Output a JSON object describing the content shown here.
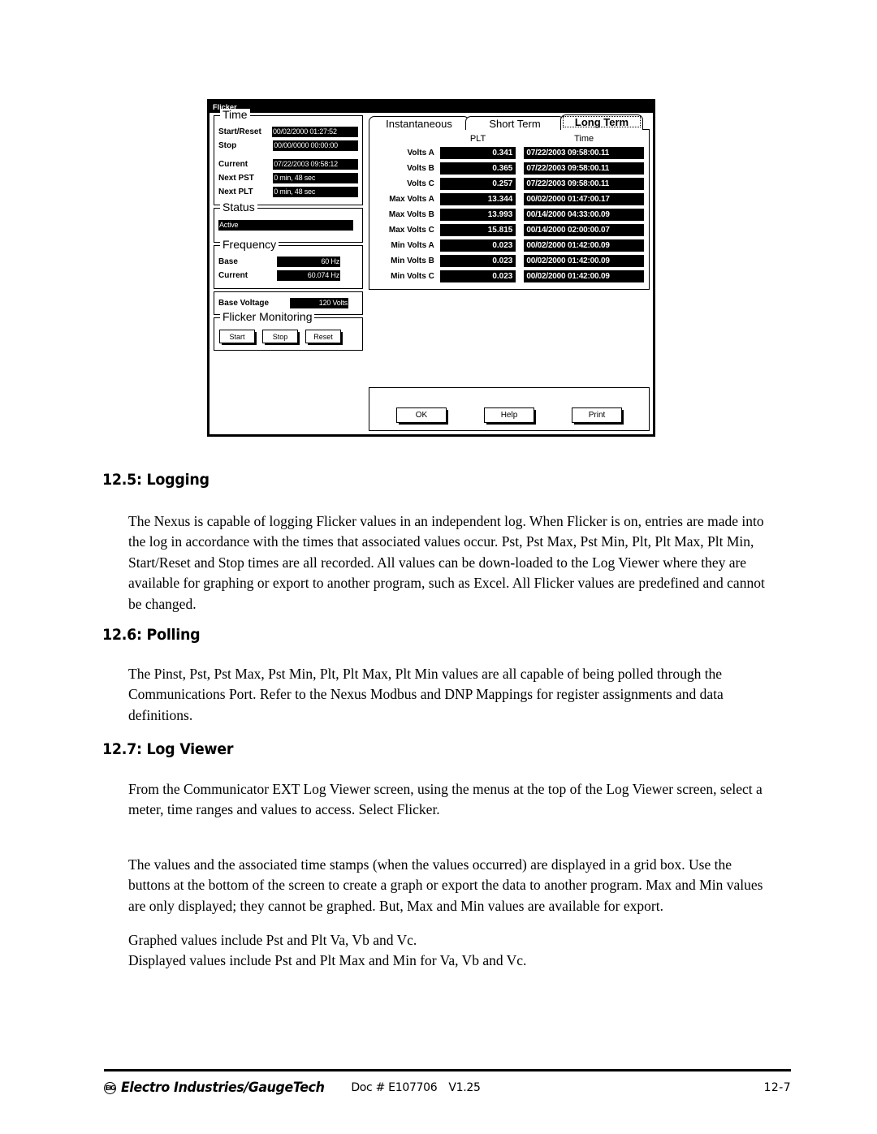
{
  "dialog": {
    "title": "Flicker",
    "time_group": {
      "legend": "Time",
      "rows": [
        {
          "label": "Start/Reset",
          "value": "00/02/2000 01:27:52"
        },
        {
          "label": "Stop",
          "value": "00/00/0000 00:00:00"
        },
        {
          "label": "Current",
          "value": "07/22/2003 09:58:12"
        },
        {
          "label": "Next PST",
          "value": "0 min, 48 sec"
        },
        {
          "label": "Next PLT",
          "value": "0 min, 48 sec"
        }
      ]
    },
    "status_group": {
      "legend": "Status",
      "value": "Active"
    },
    "frequency_group": {
      "legend": "Frequency",
      "rows": [
        {
          "label": "Base",
          "value": "60 Hz"
        },
        {
          "label": "Current",
          "value": "60.074 Hz"
        }
      ]
    },
    "base_voltage": {
      "label": "Base Voltage",
      "value": "120 Volts"
    },
    "monitoring_group": {
      "legend": "Flicker Monitoring",
      "buttons": [
        "Start",
        "Stop",
        "Reset"
      ]
    },
    "tabs": [
      {
        "label": "Instantaneous",
        "selected": false
      },
      {
        "label": "Short Term",
        "selected": false
      },
      {
        "label": "Long Term",
        "selected": true
      }
    ],
    "grid": {
      "columns": [
        "",
        "PLT",
        "Time"
      ],
      "rows": [
        {
          "label": "Volts A",
          "value": "0.341",
          "time": "07/22/2003 09:58:00.11"
        },
        {
          "label": "Volts B",
          "value": "0.365",
          "time": "07/22/2003 09:58:00.11"
        },
        {
          "label": "Volts C",
          "value": "0.257",
          "time": "07/22/2003 09:58:00.11"
        },
        {
          "label": "Max Volts A",
          "value": "13.344",
          "time": "00/02/2000 01:47:00.17"
        },
        {
          "label": "Max Volts B",
          "value": "13.993",
          "time": "00/14/2000 04:33:00.09"
        },
        {
          "label": "Max Volts C",
          "value": "15.815",
          "time": "00/14/2000 02:00:00.07"
        },
        {
          "label": "Min Volts A",
          "value": "0.023",
          "time": "00/02/2000 01:42:00.09"
        },
        {
          "label": "Min Volts B",
          "value": "0.023",
          "time": "00/02/2000 01:42:00.09"
        },
        {
          "label": "Min Volts C",
          "value": "0.023",
          "time": "00/02/2000 01:42:00.09"
        }
      ]
    },
    "action_buttons": [
      "OK",
      "Help",
      "Print"
    ]
  },
  "document": {
    "sections": [
      {
        "heading": "12.5: Logging",
        "body": "The Nexus is capable of logging Flicker values in an independent log.  When Flicker is on, entries are made into the log in accordance with the times that associated values occur.    Pst, Pst Max, Pst Min, Plt, Plt Max, Plt Min, Start/Reset and Stop times are all recorded.  All values can be down-loaded to the Log Viewer where they are available for graphing or export to another program, such as Excel.  All Flicker values are predefined and cannot be changed."
      },
      {
        "heading": "12.6: Polling",
        "body": "The Pinst, Pst, Pst Max, Pst Min, Plt, Plt Max, Plt Min values are all capable of being polled through the Communications Port.  Refer to the Nexus Modbus and DNP Mappings for register assignments and data definitions."
      },
      {
        "heading": "12.7: Log Viewer",
        "body1": "From the Communicator EXT Log Viewer screen, using the menus at the top of the Log Viewer screen, select a meter, time ranges and values to access.  Select Flicker.",
        "body2": "The values and the associated time stamps (when the values occurred) are displayed in a grid box.  Use the buttons at the bottom of the screen to create a graph or export the data to another program.  Max and Min values are only displayed; they cannot be graphed.  But, Max and Min values are available for export.",
        "body3": "Graphed values include Pst and Plt Va, Vb and Vc.\nDisplayed values include Pst and Plt Max and Min for Va, Vb and Vc."
      }
    ]
  },
  "footer": {
    "logo_text": "EIG",
    "brand": "Electro Industries/GaugeTech",
    "doc": "Doc # E107706",
    "version": "V1.25",
    "page": "12-7"
  }
}
